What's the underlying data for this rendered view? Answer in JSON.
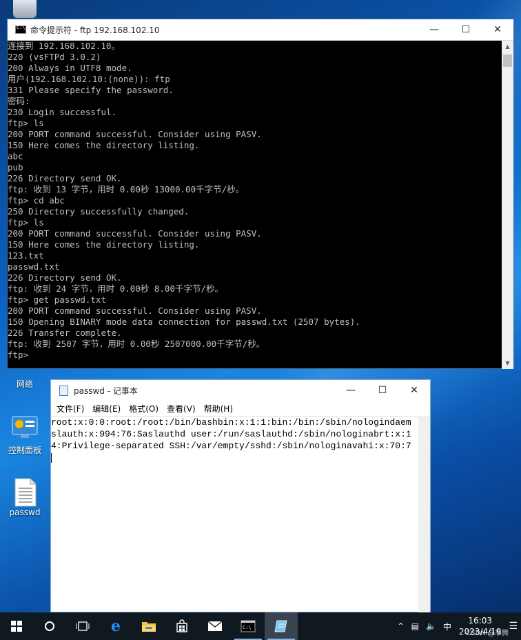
{
  "desktop": {
    "icons": [
      {
        "label": "网络"
      },
      {
        "label": "控制面板"
      },
      {
        "label": "passwd"
      }
    ]
  },
  "cmd": {
    "title": "命令提示符 - ftp  192.168.102.10",
    "lines": [
      "连接到 192.168.102.10。",
      "220 (vsFTPd 3.0.2)",
      "200 Always in UTF8 mode.",
      "用户(192.168.102.10:(none)): ftp",
      "331 Please specify the password.",
      "密码:",
      "230 Login successful.",
      "ftp> ls",
      "200 PORT command successful. Consider using PASV.",
      "150 Here comes the directory listing.",
      "abc",
      "pub",
      "226 Directory send OK.",
      "ftp: 收到 13 字节，用时 0.00秒 13000.00千字节/秒。",
      "ftp> cd abc",
      "250 Directory successfully changed.",
      "ftp> ls",
      "200 PORT command successful. Consider using PASV.",
      "150 Here comes the directory listing.",
      "123.txt",
      "passwd.txt",
      "226 Directory send OK.",
      "ftp: 收到 24 字节，用时 0.00秒 8.00千字节/秒。",
      "ftp> get passwd.txt",
      "200 PORT command successful. Consider using PASV.",
      "150 Opening BINARY mode data connection for passwd.txt (2507 bytes).",
      "226 Transfer complete.",
      "ftp: 收到 2507 字节，用时 0.00秒 2507000.00千字节/秒。",
      "ftp>"
    ]
  },
  "notepad": {
    "title": "passwd - 记事本",
    "menu": [
      "文件(F)",
      "编辑(E)",
      "格式(O)",
      "查看(V)",
      "帮助(H)"
    ],
    "lines": [
      "root:x:0:0:root:/root:/bin/bashbin:x:1:1:bin:/bin:/sbin/nologindaem",
      "slauth:x:994:76:Saslauthd user:/run/saslauthd:/sbin/nologinabrt:x:1",
      "4:Privilege-separated SSH:/var/empty/sshd:/sbin/nologinavahi:x:70:7"
    ]
  },
  "taskbar": {
    "ime": "中",
    "time": "16:03",
    "date": "2023/4/19",
    "watermark": "CSDN @韦腾"
  }
}
